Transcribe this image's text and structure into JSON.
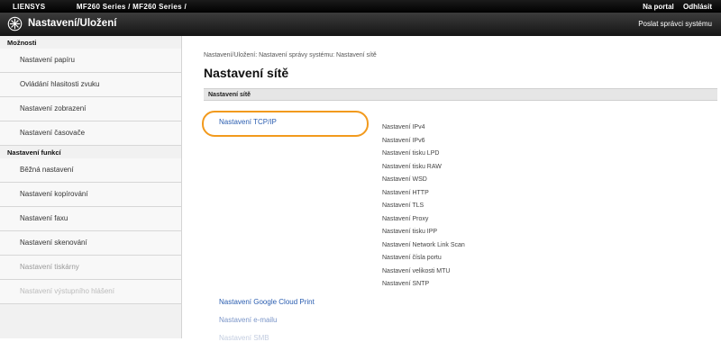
{
  "topbar": {
    "left_items": [
      "LIENSYS",
      "MF260 Series / MF260 Series /"
    ],
    "portal": "Na portal",
    "logout": "Odhlásit"
  },
  "header": {
    "title": "Nastavení/Uložení",
    "admin_link": "Poslat správci systému"
  },
  "sidebar": {
    "sections": [
      {
        "label": "Možnosti",
        "items": [
          "Nastavení papíru",
          "Ovládání hlasitosti zvuku",
          "Nastavení zobrazení",
          "Nastavení časovače"
        ]
      },
      {
        "label": "Nastavení funkcí",
        "items": [
          "Běžná nastavení",
          "Nastavení kopírování",
          "Nastavení faxu",
          "Nastavení skenování",
          "Nastavení tiskárny",
          "Nastavení výstupního hlášení"
        ]
      }
    ]
  },
  "main": {
    "breadcrumb": "Nastavení/Uložení: Nastavení správy systému: Nastavení sítě",
    "title": "Nastavení sítě",
    "section_header": "Nastavení sítě",
    "tcpip_link": "Nastavení TCP/IP",
    "sublinks": [
      "Nastavení IPv4",
      "Nastavení IPv6",
      "Nastavení tisku LPD",
      "Nastavení tisku RAW",
      "Nastavení WSD",
      "Nastavení HTTP",
      "Nastavení TLS",
      "Nastavení Proxy",
      "Nastavení tisku IPP",
      "Nastavení Network Link Scan",
      "Nastavení čísla portu",
      "Nastavení velikosti MTU",
      "Nastavení SNTP"
    ],
    "other_links": [
      "Nastavení Google Cloud Print",
      "Nastavení e-mailu",
      "Nastavení SMB"
    ]
  },
  "colors": {
    "highlight": "#f29a1d",
    "link": "#2a5db0"
  }
}
